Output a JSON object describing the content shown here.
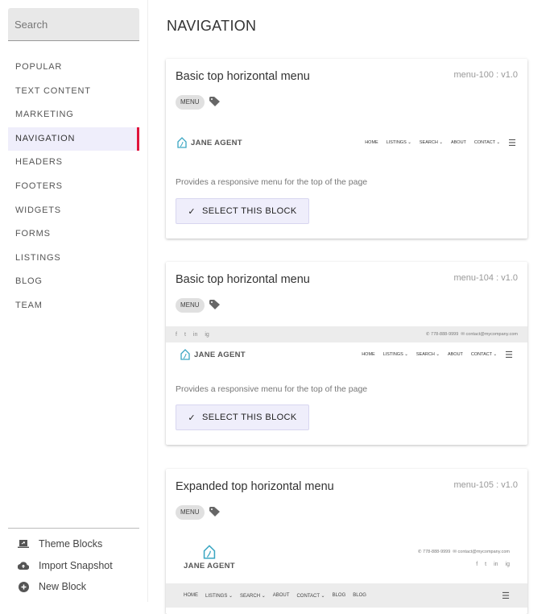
{
  "sidebar": {
    "search_placeholder": "Search",
    "items": [
      "POPULAR",
      "TEXT CONTENT",
      "MARKETING",
      "NAVIGATION",
      "HEADERS",
      "FOOTERS",
      "WIDGETS",
      "FORMS",
      "LISTINGS",
      "BLOG",
      "TEAM"
    ],
    "active": "NAVIGATION",
    "bottom": [
      {
        "label": "Theme Blocks",
        "icon": "laptop-icon"
      },
      {
        "label": "Import Snapshot",
        "icon": "cloud-upload-icon"
      },
      {
        "label": "New Block",
        "icon": "add-circle-icon"
      }
    ]
  },
  "page": {
    "title": "NAVIGATION"
  },
  "accent": "#e0143c",
  "cards": [
    {
      "title": "Basic top horizontal menu",
      "version": "menu-100 : v1.0",
      "chip": "MENU",
      "description": "Provides a responsive menu for the top of the page",
      "button": "SELECT THIS BLOCK"
    },
    {
      "title": "Basic top horizontal menu",
      "version": "menu-104 : v1.0",
      "chip": "MENU",
      "description": "Provides a responsive menu for the top of the page",
      "button": "SELECT THIS BLOCK"
    },
    {
      "title": "Expanded top horizontal menu",
      "version": "menu-105 : v1.0",
      "chip": "MENU"
    }
  ],
  "preview": {
    "brand": "JANE AGENT",
    "phone": "778-888-9999",
    "email": "contact@mycompany.com",
    "menu": [
      "HOME",
      "LISTINGS",
      "SEARCH",
      "ABOUT",
      "CONTACT"
    ],
    "menu_expanded": [
      "HOME",
      "LISTINGS",
      "SEARCH",
      "ABOUT",
      "CONTACT",
      "BLOG",
      "BLOG"
    ],
    "social": [
      "f",
      "t",
      "in",
      "ig"
    ]
  }
}
